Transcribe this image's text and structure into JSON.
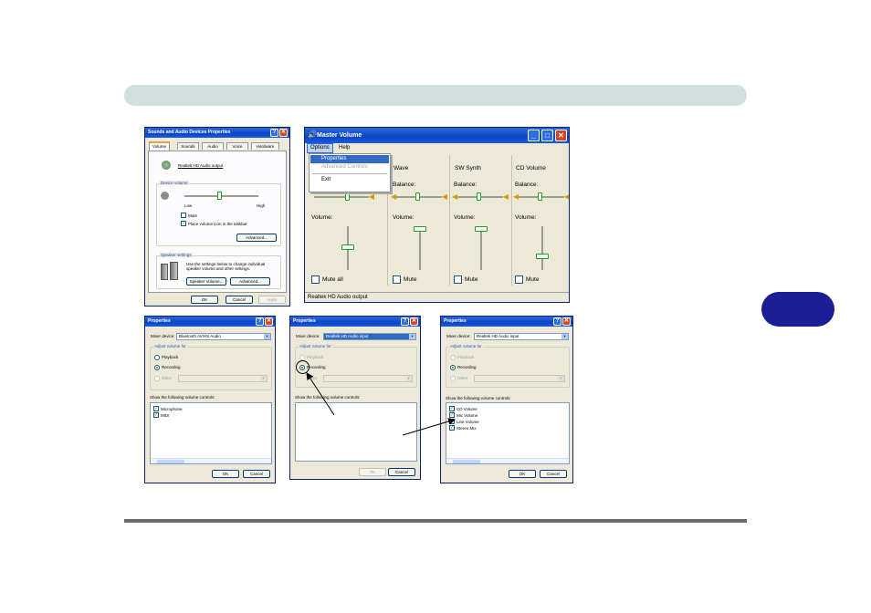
{
  "sound_props": {
    "title": "Sounds and Audio Devices Properties",
    "tabs": [
      "Volume",
      "Sounds",
      "Audio",
      "Voice",
      "Hardware"
    ],
    "device_name": "Realtek HD Audio output",
    "device_volume_group": "Device volume",
    "low": "Low",
    "high": "High",
    "mute": "Mute",
    "place_icon": "Place volume icon in the taskbar",
    "advanced_btn": "Advanced...",
    "speaker_group": "Speaker settings",
    "speaker_text_1": "Use the settings below to change individual",
    "speaker_text_2": "speaker volume and other settings.",
    "speaker_volume_btn": "Speaker Volume...",
    "advanced_btn2": "Advanced...",
    "ok": "OK",
    "cancel": "Cancel",
    "apply": "Apply"
  },
  "master_volume": {
    "title": "Master Volume",
    "menu": [
      "Options",
      "Help"
    ],
    "dropdown": [
      "Properties",
      "Advanced Controls",
      "Exit"
    ],
    "columns": [
      {
        "name": "Wave"
      },
      {
        "name": "SW Synth"
      },
      {
        "name": "CD Volume"
      }
    ],
    "balance_label": "Balance:",
    "volume_label": "Volume:",
    "mute_all": "Mute all",
    "mute": "Mute",
    "status": "Realtek HD Audio output"
  },
  "props_1": {
    "title": "Properties",
    "mixer_label": "Mixer device:",
    "mixer_value": "Bluetooth AV/HS Audio",
    "adjust_label": "Adjust volume for",
    "playback": "Playback",
    "recording": "Recording",
    "other": "Other",
    "show_label": "Show the following volume controls:",
    "items": [
      "Microphone",
      "MIDI"
    ],
    "ok": "OK",
    "cancel": "Cancel"
  },
  "props_2": {
    "title": "Properties",
    "mixer_label": "Mixer device:",
    "mixer_value": "Realtek HD Audio input",
    "adjust_label": "Adjust volume for",
    "playback": "Playback",
    "recording": "Recording",
    "other": "Other",
    "show_label": "Show the following volume controls:",
    "ok": "OK",
    "cancel": "Cancel"
  },
  "props_3": {
    "title": "Properties",
    "mixer_label": "Mixer device:",
    "mixer_value": "Realtek HD Audio input",
    "adjust_label": "Adjust volume for",
    "playback": "Playback",
    "recording": "Recording",
    "other": "Other",
    "show_label": "Show the following volume controls:",
    "items": [
      "CD Volume",
      "Mic Volume",
      "Line Volume",
      "Stereo Mix"
    ],
    "ok": "OK",
    "cancel": "Cancel"
  },
  "colors": {
    "topbar": "#cfe0df",
    "chapter_tab": "#1a1f96",
    "xp_blue": "#0a46c4"
  }
}
